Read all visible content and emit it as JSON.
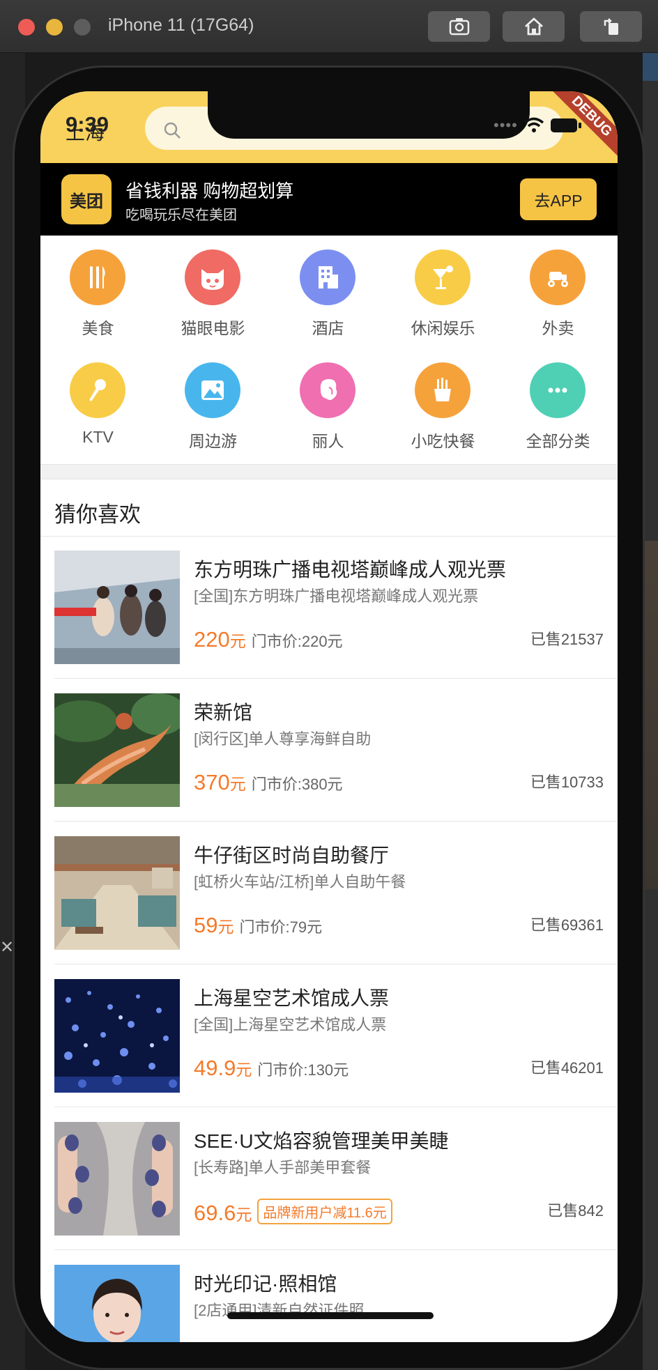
{
  "simulator": {
    "title": "iPhone 11 (17G64)",
    "buttons": [
      "screenshot",
      "home",
      "rotate"
    ]
  },
  "status_bar": {
    "time": "9:39",
    "debug_banner": "DEBUG"
  },
  "header": {
    "city": "上海",
    "search_placeholder": ""
  },
  "promo": {
    "logo_text": "美团",
    "title": "省钱利器 购物超划算",
    "subtitle": "吃喝玩乐尽在美团",
    "button": "去APP"
  },
  "categories": [
    {
      "label": "美食",
      "icon": "fork-knife-icon",
      "color": "#f6a23b"
    },
    {
      "label": "猫眼电影",
      "icon": "cat-icon",
      "color": "#ef6b63"
    },
    {
      "label": "酒店",
      "icon": "hotel-icon",
      "color": "#7c8ff0"
    },
    {
      "label": "休闲娱乐",
      "icon": "cocktail-icon",
      "color": "#f9cc47"
    },
    {
      "label": "外卖",
      "icon": "scooter-icon",
      "color": "#f6a23b"
    },
    {
      "label": "KTV",
      "icon": "microphone-icon",
      "color": "#f9cc47"
    },
    {
      "label": "周边游",
      "icon": "landscape-icon",
      "color": "#48b6ec"
    },
    {
      "label": "丽人",
      "icon": "woman-icon",
      "color": "#ef6fb1"
    },
    {
      "label": "小吃快餐",
      "icon": "fries-icon",
      "color": "#f6a23b"
    },
    {
      "label": "全部分类",
      "icon": "more-icon",
      "color": "#4fd0b5"
    }
  ],
  "guess_title": "猜你喜欢",
  "items": [
    {
      "title": "东方明珠广播电视塔巅峰成人观光票",
      "subtitle": "[全国]东方明珠广播电视塔巅峰成人观光票",
      "price": "220",
      "unit": "元",
      "original": "门市价:220元",
      "tag": "",
      "sold": "已售21537"
    },
    {
      "title": "荣新馆",
      "subtitle": "[闵行区]单人尊享海鲜自助",
      "price": "370",
      "unit": "元",
      "original": "门市价:380元",
      "tag": "",
      "sold": "已售10733"
    },
    {
      "title": "牛仔街区时尚自助餐厅",
      "subtitle": "[虹桥火车站/江桥]单人自助午餐",
      "price": "59",
      "unit": "元",
      "original": "门市价:79元",
      "tag": "",
      "sold": "已售69361"
    },
    {
      "title": "上海星空艺术馆成人票",
      "subtitle": "[全国]上海星空艺术馆成人票",
      "price": "49.9",
      "unit": "元",
      "original": "门市价:130元",
      "tag": "",
      "sold": "已售46201"
    },
    {
      "title": "SEE·U文焰容貌管理美甲美睫",
      "subtitle": "[长寿路]单人手部美甲套餐",
      "price": "69.6",
      "unit": "元",
      "original": "",
      "tag": "品牌新用户减11.6元",
      "sold": "已售842"
    },
    {
      "title": "时光印记·照相馆",
      "subtitle": "[2店通用]清新自然证件照",
      "price": "",
      "unit": "",
      "original": "",
      "tag": "",
      "sold": ""
    }
  ]
}
